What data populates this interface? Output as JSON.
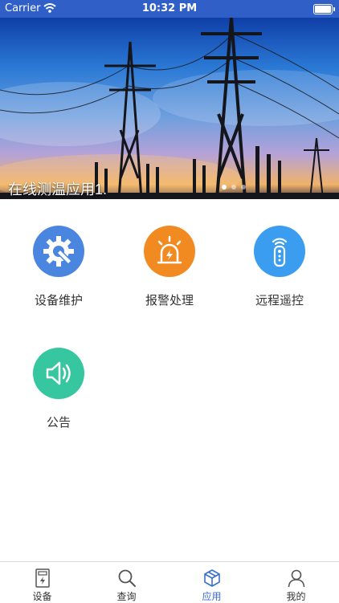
{
  "status_bar": {
    "carrier": "Carrier",
    "time": "10:32 PM"
  },
  "banner": {
    "caption": "在线测温应用1.",
    "page_count": 3,
    "active_index": 0
  },
  "apps": [
    {
      "label": "设备维护",
      "icon": "gear-wrench-icon",
      "color": "#4a86e0"
    },
    {
      "label": "报警处理",
      "icon": "alarm-siren-icon",
      "color": "#f28a22"
    },
    {
      "label": "远程遥控",
      "icon": "remote-control-icon",
      "color": "#3a9df0"
    },
    {
      "label": "公告",
      "icon": "speaker-icon",
      "color": "#37c7a0"
    }
  ],
  "tabs": [
    {
      "label": "设备",
      "icon": "device-icon"
    },
    {
      "label": "查询",
      "icon": "search-icon"
    },
    {
      "label": "应用",
      "icon": "cube-icon",
      "active": true
    },
    {
      "label": "我的",
      "icon": "user-icon"
    }
  ],
  "colors": {
    "status_bar": "#2f5fc7",
    "tab_active": "#3b6fd0"
  }
}
